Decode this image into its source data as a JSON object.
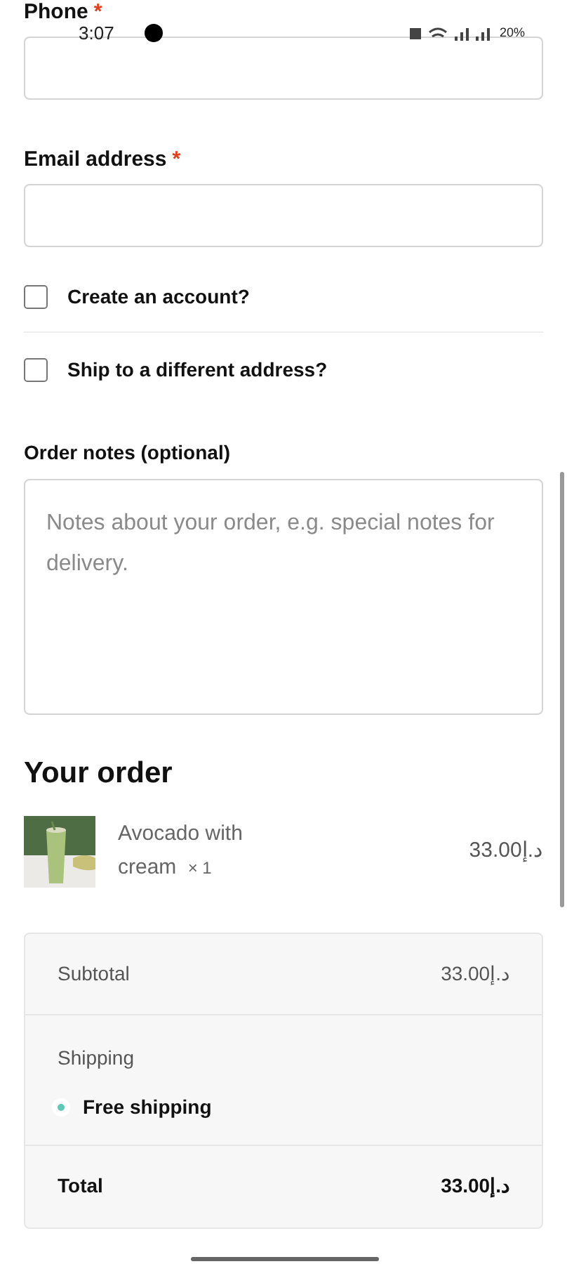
{
  "status_bar": {
    "time": "3:07",
    "battery": "20%"
  },
  "fields": [
    {
      "label": "Phone",
      "required_mark": "*",
      "kind": "input"
    },
    {
      "label": "Email address",
      "required_mark": "*",
      "kind": "input"
    }
  ],
  "options": [
    {
      "label": "Create an account?",
      "checked": false
    },
    {
      "label": "Ship to a different address?",
      "checked": false
    }
  ],
  "order_notes": {
    "label": "Order notes (optional)",
    "placeholder": "Notes about your order, e.g. special notes for delivery."
  },
  "order": {
    "title": "Your order",
    "items": [
      {
        "name": "Avocado with cream",
        "quantity": "× 1",
        "price": "33.00د.إ"
      }
    ],
    "subtotal": {
      "label": "Subtotal",
      "value": "33.00د.إ"
    },
    "shipping": {
      "label": "Shipping",
      "methods": [
        {
          "label": "Free shipping",
          "selected": true
        }
      ]
    },
    "total": {
      "label": "Total",
      "value": "33.00د.إ"
    }
  }
}
